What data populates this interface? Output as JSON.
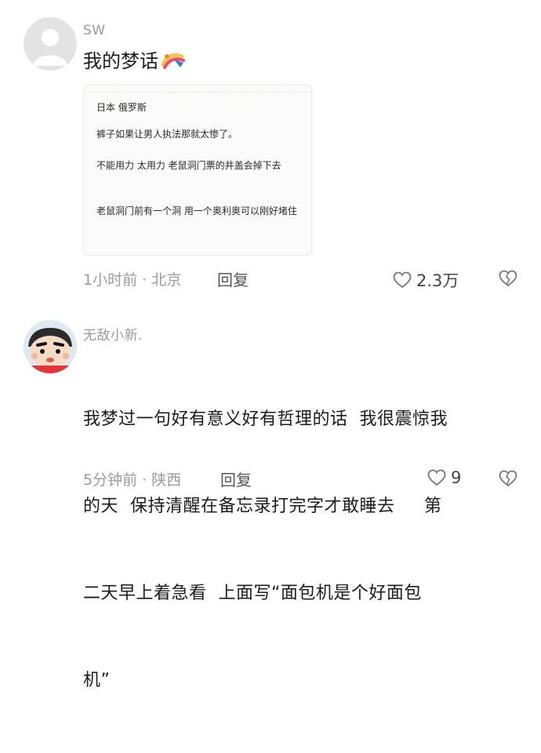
{
  "comments": [
    {
      "username": "SW",
      "text": "我的梦话",
      "card_lines": [
        "日本 俄罗斯",
        "裤子如果让男人执法那就太惨了。",
        "不能用力 太用力 老鼠洞门票的井盖会掉下去",
        "老鼠洞门前有一个洞 用一个奥利奥可以刚好堵住"
      ],
      "time_location": "1小时前 · 北京",
      "reply_label": "回复",
      "likes": "2.3万"
    },
    {
      "username": "无敌小新.",
      "text_lines": [
        "我梦过一句好有意义好有哲理的话  我很震惊我",
        "的天  保持清醒在备忘录打完字才敢睡去     第",
        "二天早上着急看  上面写“面包机是个好面包",
        "机”"
      ],
      "time_location": "5分钟前 · 陕西",
      "reply_label": "回复",
      "likes": "9"
    }
  ],
  "colors": {
    "meta": "#9b9b9b",
    "avatar_default": "#e3e3e3"
  }
}
